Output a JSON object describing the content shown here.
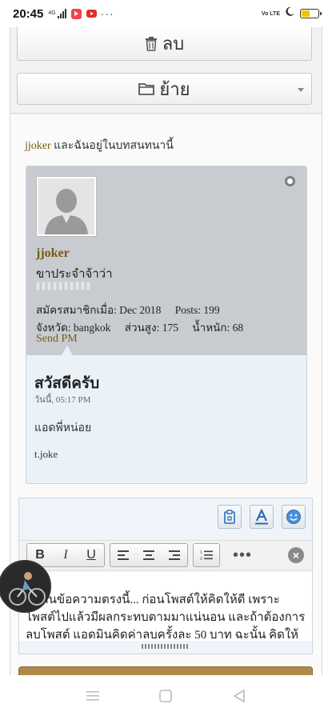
{
  "status_bar": {
    "time": "20:45",
    "network": "4G",
    "volte": "Vo LTE",
    "more": "···"
  },
  "actions": {
    "delete_label": "ลบ",
    "move_label": "ย้าย"
  },
  "readers": {
    "username": "jjoker",
    "text": " และฉันอยู่ในบทสนทนานี้"
  },
  "post": {
    "author": "jjoker",
    "user_title": "ขาประจำจ้าว่า",
    "join_date": "สมัครสมาชิกเมื่อ: Dec 2018",
    "posts": "Posts: 199",
    "province": "จังหวัด: bangkok",
    "height": "ส่วนสูง: 175",
    "weight": "น้ำหนัก: 68",
    "send_pm": "Send PM",
    "title": "สวัสดีครับ",
    "date": "วันนี้, 05:17 PM",
    "body": "แอดพี่หน่อย",
    "signature": "t.joke"
  },
  "editor": {
    "bold": "B",
    "italic": "I",
    "underline": "U",
    "more": "•••",
    "close": "×",
    "text": "...อ่านข้อความตรงนี้... ก่อนโพสต์ให้คิดให้ดี เพราะโพสต์ไปแล้วมีผลกระทบตามมาแน่นอน และถ้าต้องการลบโพสต์ แอดมินคิดค่าลบครั้งละ 50 บาท ฉะนั้น คิดให้"
  },
  "colors": {
    "username": "#7a5a12",
    "userinfo_bg": "#c8ccd0",
    "postbody_bg": "#eaf2f8",
    "accent_blue": "#2a6db5"
  }
}
